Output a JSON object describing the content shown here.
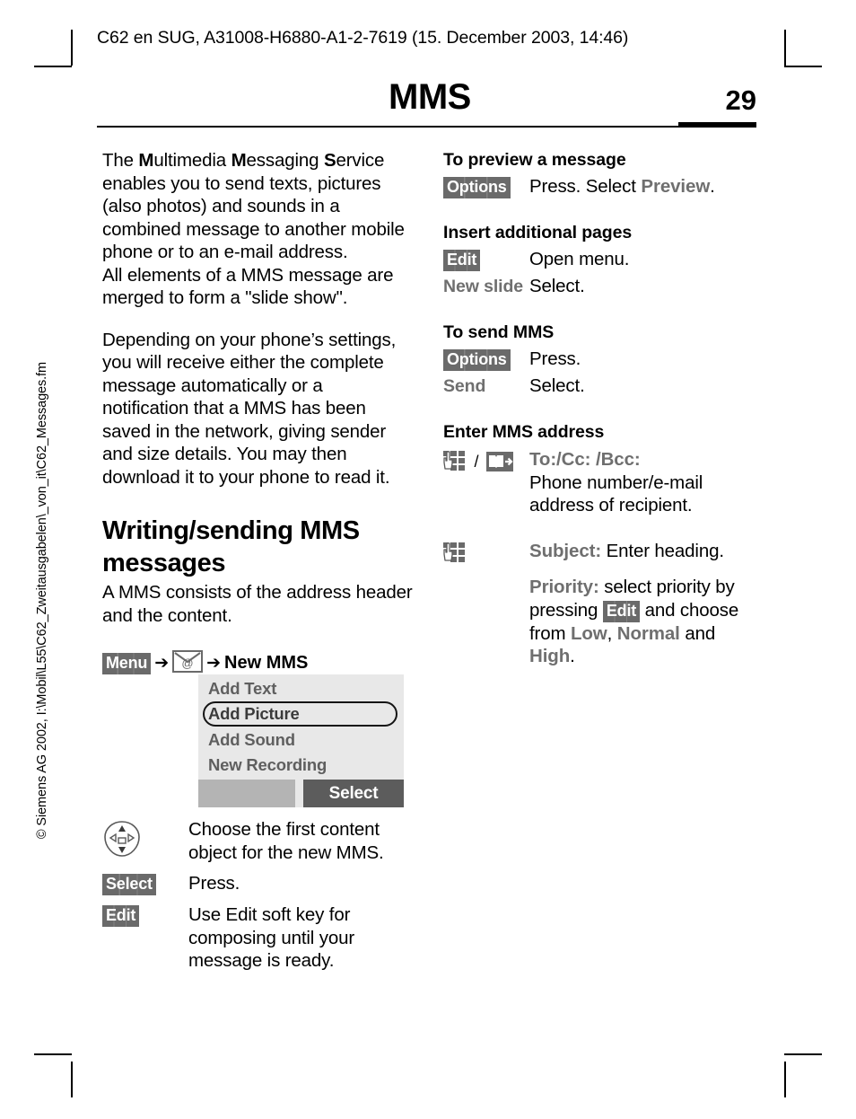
{
  "document": {
    "running_header": "C62 en SUG, A31008-H6880-A1-2-7619 (15. December 2003, 14:46)",
    "chapter_title": "MMS",
    "page_number": "29",
    "side_note": "© Siemens AG 2002, I:\\Mobil\\L55\\C62_Zweitausgabelen\\_von_it\\C62_Messages.fm"
  },
  "left_column": {
    "intro_para_1_segments": {
      "t1": "The ",
      "b1": "M",
      "t2": "ultimedia ",
      "b2": "M",
      "t3": "essaging ",
      "b3": "S",
      "t4": "ervice enables you to send texts, pictures (also photos) and sounds in a combined message to another mobile phone or to an e-mail address."
    },
    "intro_para_1b": "All elements of a MMS message are merged to form a \"slide show\".",
    "intro_para_2": "Depending on your phone’s settings, you will receive either the complete message automatically or a notification that a MMS has been saved in the network, giving sender and size details. You may then download it to your phone to read it.",
    "section_heading": "Writing/sending MMS messages",
    "section_para": "A MMS consists of the address header and the content.",
    "nav_path": {
      "menu_key": "Menu",
      "arrow": "➔",
      "messages_icon": "messages-envelope-at-icon",
      "target": "New MMS"
    },
    "phone_screen": {
      "items": [
        "Add Text",
        "Add Picture",
        "Add Sound",
        "New Recording"
      ],
      "highlighted_index": 1,
      "softkey_left": "",
      "softkey_right": "Select",
      "bg_color": "#e8e8e8",
      "softkey_left_color": "#b4b4b4",
      "softkey_right_color": "#5c5c5c"
    },
    "steps": [
      {
        "lead_type": "joystick-icon",
        "lead": "",
        "desc": "Choose the first content object for the new MMS."
      },
      {
        "lead_type": "key",
        "lead": "Select",
        "desc": "Press."
      },
      {
        "lead_type": "key",
        "lead": "Edit",
        "desc": "Use Edit soft key for composing until your message is ready."
      }
    ]
  },
  "right_column": {
    "sections": [
      {
        "heading": "To preview a message",
        "rows": [
          {
            "lead_type": "key",
            "lead": "Options",
            "desc_pre": "Press. Select ",
            "desc_mi": "Preview",
            "desc_post": "."
          }
        ]
      },
      {
        "heading": "Insert additional pages",
        "rows": [
          {
            "lead_type": "key",
            "lead": "Edit",
            "desc_pre": "Open menu.",
            "desc_mi": "",
            "desc_post": ""
          },
          {
            "lead_type": "mi",
            "lead": "New slide",
            "desc_pre": "Select.",
            "desc_mi": "",
            "desc_post": ""
          }
        ]
      },
      {
        "heading": "To send MMS",
        "rows": [
          {
            "lead_type": "key",
            "lead": "Options",
            "desc_pre": "Press.",
            "desc_mi": "",
            "desc_post": ""
          },
          {
            "lead_type": "mi",
            "lead": "Send",
            "desc_pre": "Select.",
            "desc_mi": "",
            "desc_post": ""
          }
        ]
      }
    ],
    "address_section": {
      "heading": "Enter MMS address",
      "row1": {
        "icon_keypad": "keypad-hand-icon",
        "separator": "/",
        "icon_book": "phonebook-icon",
        "label": "To:/Cc: /Bcc:",
        "text": "Phone number/e-mail address of recipient."
      },
      "row2": {
        "icon_keypad": "keypad-hand-icon",
        "subject_label": "Subject:",
        "subject_text": " Enter heading.",
        "priority_label": "Priority:",
        "priority_t1": " select priority by pressing ",
        "priority_key": "Edit",
        "priority_t2": " and choose from ",
        "priority_opt1": "Low",
        "priority_t3": ", ",
        "priority_opt2": "Normal",
        "priority_t4": " and ",
        "priority_opt3": "High",
        "priority_t5": "."
      }
    }
  }
}
